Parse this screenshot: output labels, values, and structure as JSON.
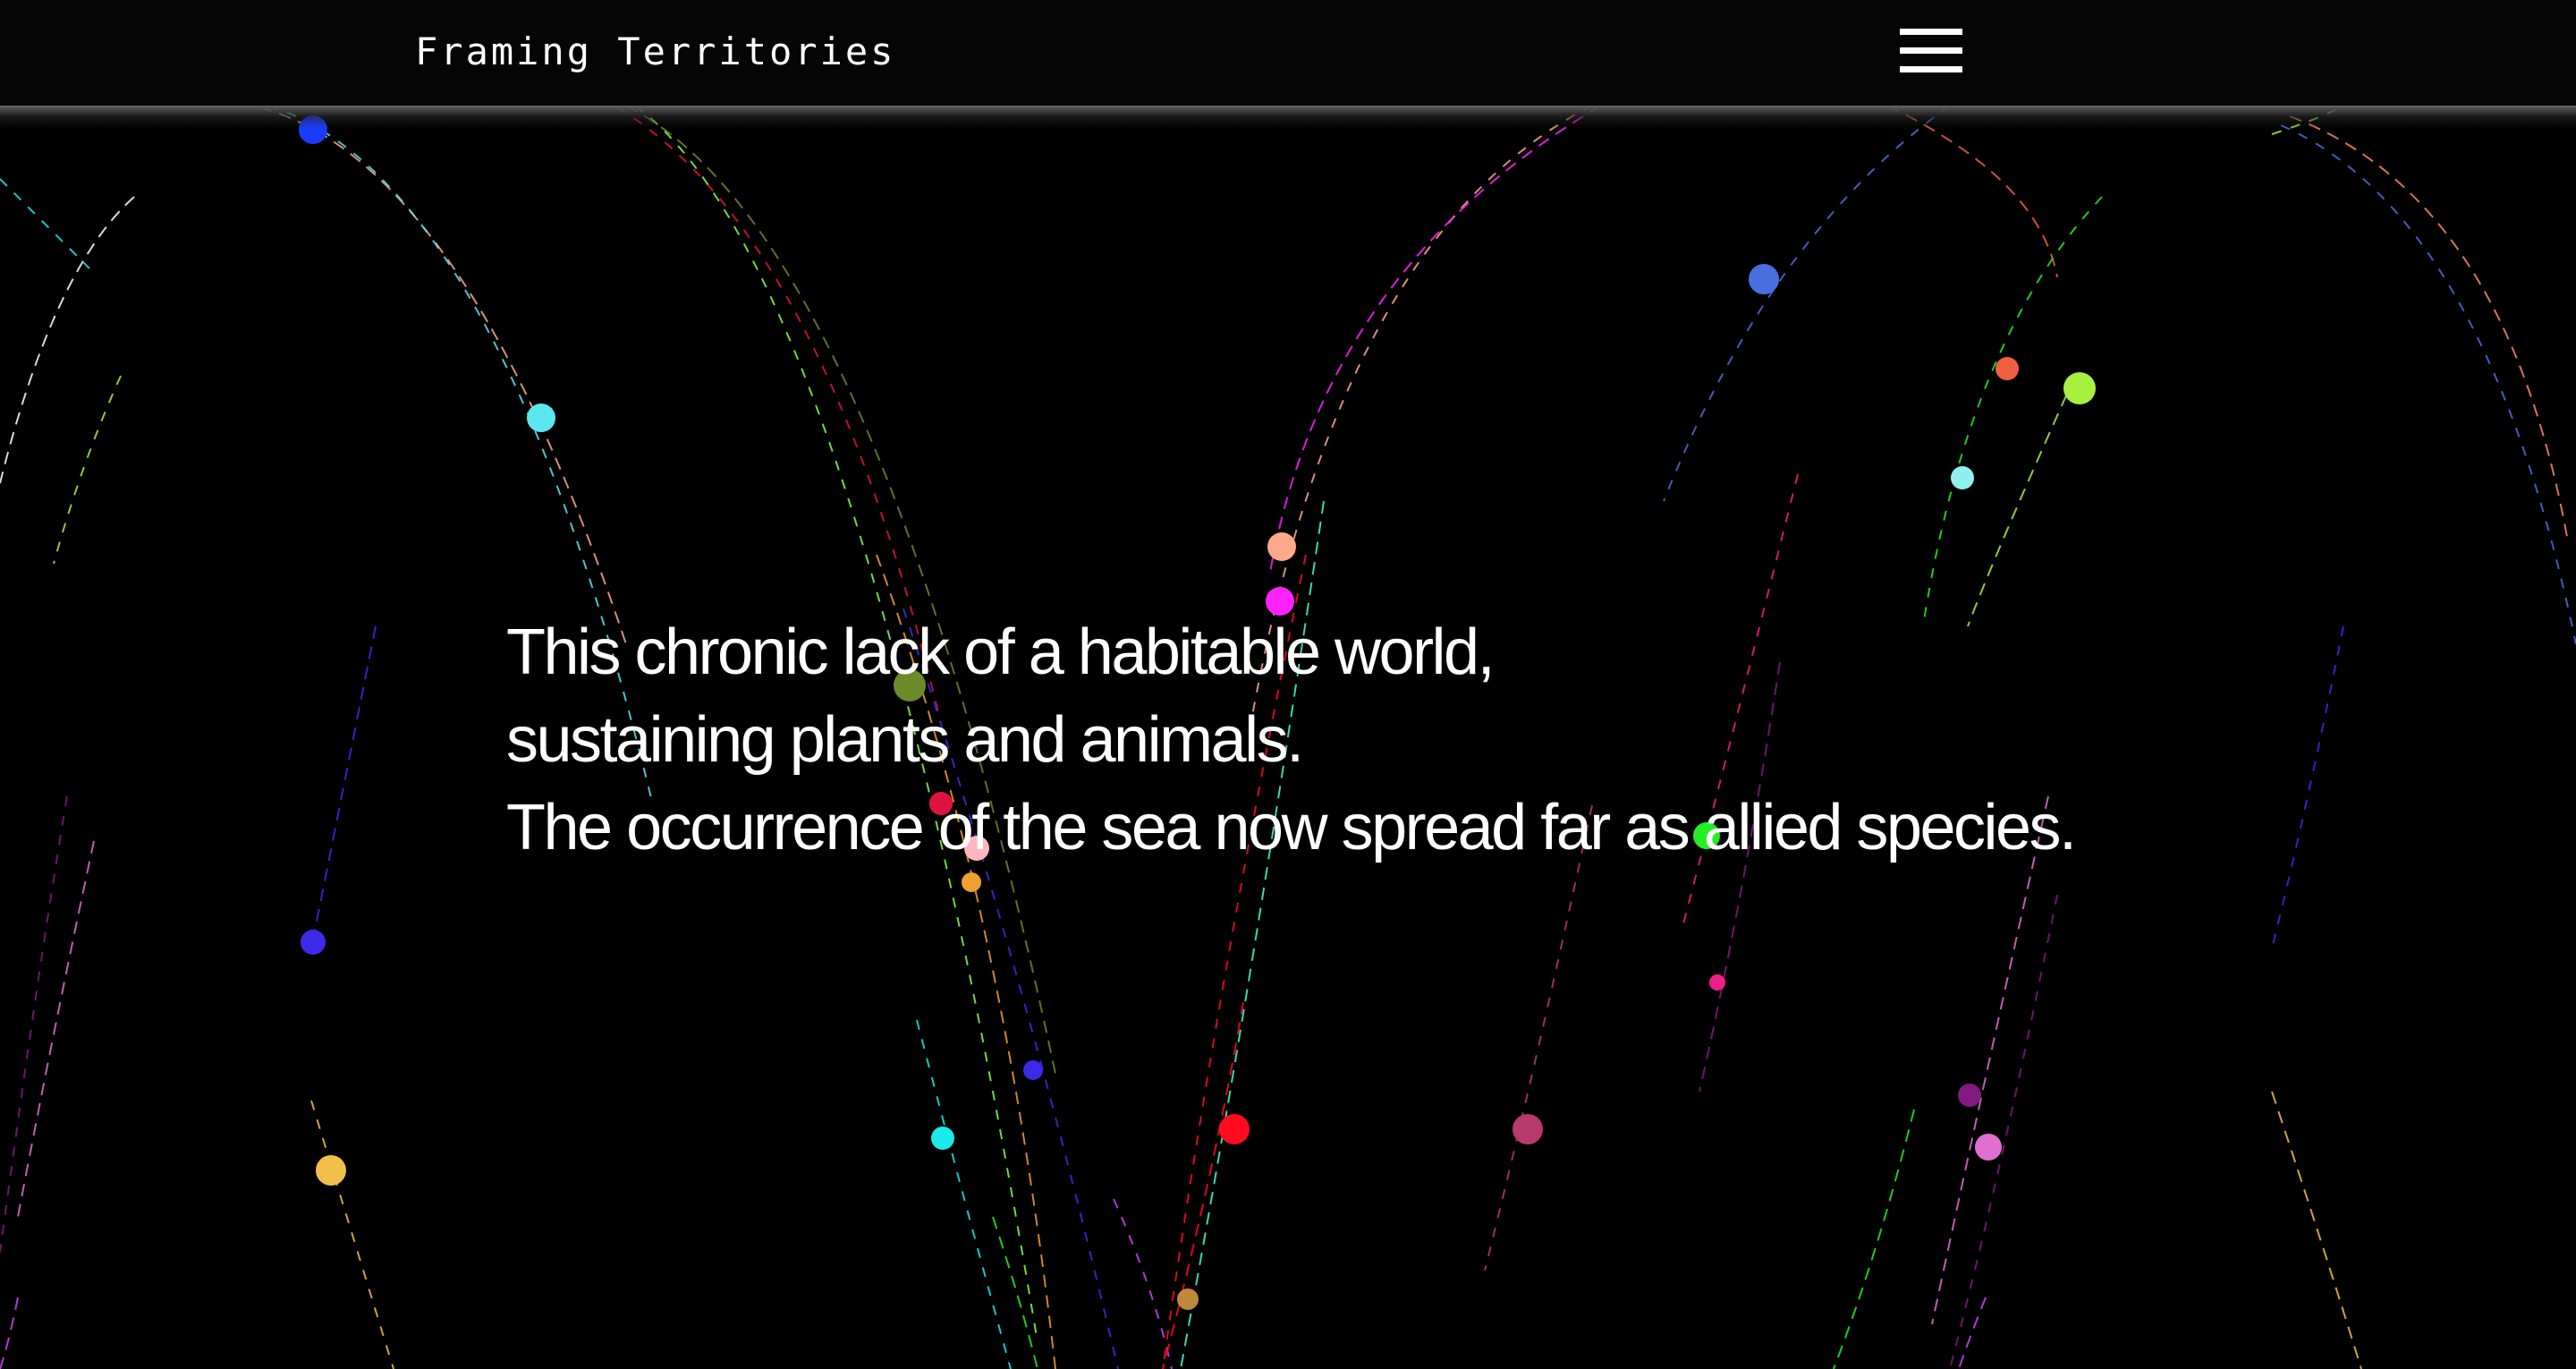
{
  "header": {
    "site_title": "Framing Territories",
    "menu_icon": "hamburger-menu-icon"
  },
  "hero": {
    "lines": [
      "This chronic lack of a habitable world,",
      "sustaining plants and animals.",
      "The occurrence of the sea now spread far as allied species."
    ]
  },
  "colors": {
    "background": "#000000",
    "text": "#ffffff",
    "dot_palette": [
      "#1a3cff",
      "#5be6f0",
      "#ffa88c",
      "#ff22ff",
      "#6b8a2a",
      "#e0123f",
      "#ffb6c1",
      "#f0a030",
      "#3b2be8",
      "#ff0a1e",
      "#f2c04a",
      "#1aeaea",
      "#c0883a",
      "#b83a6a",
      "#4a70e0",
      "#f06040",
      "#a8f040",
      "#90f0f0",
      "#22f022",
      "#f01e8a",
      "#801a80",
      "#e070d0"
    ]
  }
}
